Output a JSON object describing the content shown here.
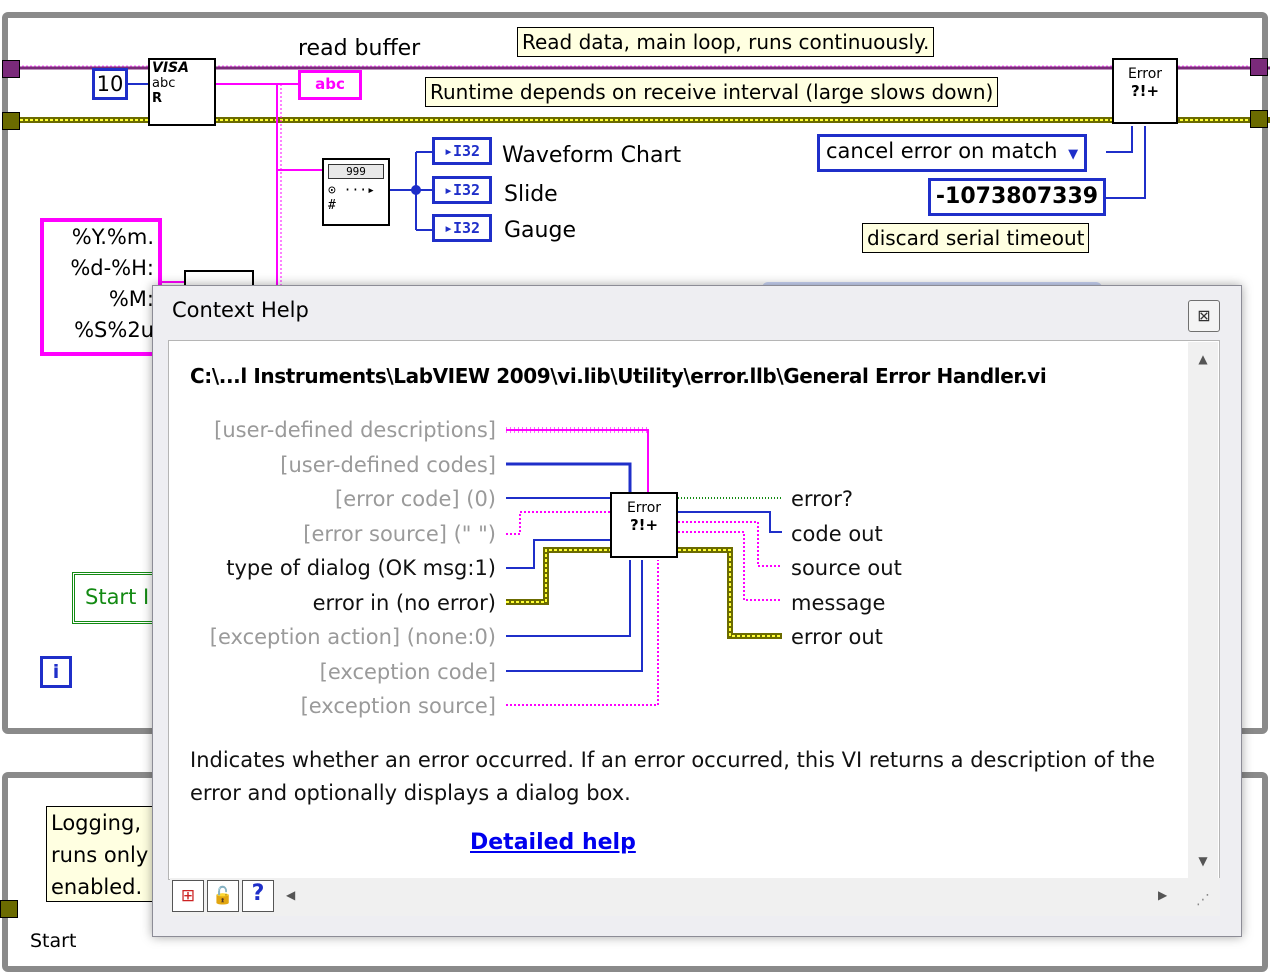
{
  "diagram": {
    "top_loop": {
      "numeric_constant": "10",
      "read_buffer_label": "read buffer",
      "abc_indicator": "abc",
      "note_main": "Read data, main loop, runs continuously.",
      "note_runtime": "Runtime depends  on receive interval (large slows down)",
      "indicators": [
        {
          "type": "I32",
          "label": "Waveform Chart"
        },
        {
          "type": "I32",
          "label": "Slide"
        },
        {
          "type": "I32",
          "label": "Gauge"
        }
      ],
      "cancel_ring": "cancel error on match",
      "error_code_constant": "-1073807339",
      "note_discard": "discard serial timeout",
      "format_string_lines": [
        "%Y.%m.",
        "%d-%H:",
        "%M:",
        "%S%2u"
      ],
      "start_button_partial": "Start I",
      "info_icon": "i",
      "visa_icon_text": "VISA",
      "display_icon_text": "999"
    },
    "bottom_loop": {
      "note_lines": [
        "Logging,",
        "runs only",
        "enabled."
      ],
      "partial_label": "Start"
    }
  },
  "help_window": {
    "title": "Context Help",
    "path": "C:\\...l Instruments\\LabVIEW 2009\\vi.lib\\Utility\\error.llb\\General Error Handler.vi",
    "vi_icon_lines": [
      "Error",
      "?!+"
    ],
    "inputs": [
      {
        "label": "[user-defined descriptions]",
        "style": "optional"
      },
      {
        "label": "[user-defined codes]",
        "style": "optional"
      },
      {
        "label": "[error code] (0)",
        "style": "optional"
      },
      {
        "label": "[error source] (\" \")",
        "style": "optional"
      },
      {
        "label": "type of dialog (OK msg:1)",
        "style": "recommended"
      },
      {
        "label": "error in (no error)",
        "style": "recommended"
      },
      {
        "label": "[exception action] (none:0)",
        "style": "optional"
      },
      {
        "label": "[exception code]",
        "style": "optional"
      },
      {
        "label": "[exception source]",
        "style": "optional"
      }
    ],
    "outputs": [
      {
        "label": "error?"
      },
      {
        "label": "code out"
      },
      {
        "label": "source out"
      },
      {
        "label": "message"
      },
      {
        "label": "error out"
      }
    ],
    "description": "Indicates whether an error occurred. If an error occurred, this VI returns a description of the error and optionally displays a dialog box.",
    "detailed_help_link": "Detailed help",
    "close_icon": "close-icon"
  },
  "colors": {
    "string_wire": "#ff00ff",
    "numeric_wire": "#1f2fc9",
    "error_wire": "#c8c800",
    "help_bg": "#ffffff",
    "note_bg": "#ffffe1",
    "link": "#0000ee"
  }
}
